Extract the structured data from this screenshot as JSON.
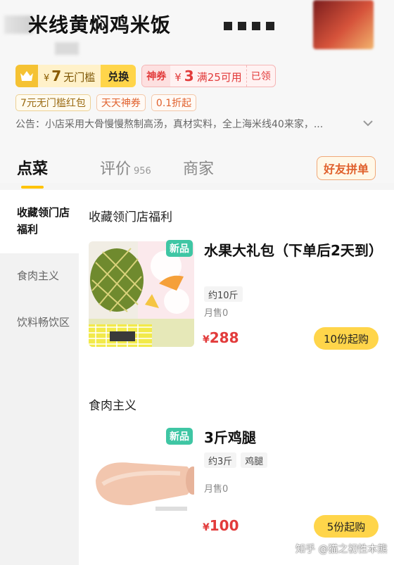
{
  "store": {
    "title": "米线黄焖鸡米饭"
  },
  "coupons": {
    "vip_symbol": "¥",
    "vip_amount": "7",
    "vip_label": "无门槛",
    "redeem_label": "兑换",
    "shenquan_tag": "神券",
    "shenquan_symbol": "¥",
    "shenquan_amount": "3",
    "shenquan_condition": "满25可用",
    "shenquan_status": "已领"
  },
  "promo_tags": [
    "7元无门槛红包",
    "天天神券",
    "0.1折起"
  ],
  "notice": "公告：小店采用大骨慢慢熬制高汤，真材实料，全上海米线40来家，...",
  "tabs": {
    "order": "点菜",
    "reviews": "评价",
    "reviews_count": "956",
    "merchant": "商家",
    "group_buy": "好友拼单"
  },
  "sidebar": {
    "items": [
      {
        "label": "收藏领门店福利"
      },
      {
        "label": "食肉主义"
      },
      {
        "label": "饮料畅饮区"
      }
    ]
  },
  "sections": [
    {
      "title": "收藏领门店福利",
      "product": {
        "badge": "新品",
        "name": "水果大礼包（下单后2天到）",
        "specs": [
          "约10斤"
        ],
        "sold": "月售0",
        "price_symbol": "¥",
        "price": "288",
        "buy_label": "10份起购"
      }
    },
    {
      "title": "食肉主义",
      "product": {
        "badge": "新品",
        "name": "3斤鸡腿",
        "specs": [
          "约3斤",
          "鸡腿"
        ],
        "sold": "月售0",
        "price_symbol": "¥",
        "price": "100",
        "buy_label": "5份起购"
      }
    }
  ],
  "watermark": "知乎 @猫之初性本熊",
  "colors": {
    "accent": "#ffc300",
    "price": "#e23b3b",
    "new_badge": "#3fc6a4",
    "buy_button": "#ffd54a"
  }
}
